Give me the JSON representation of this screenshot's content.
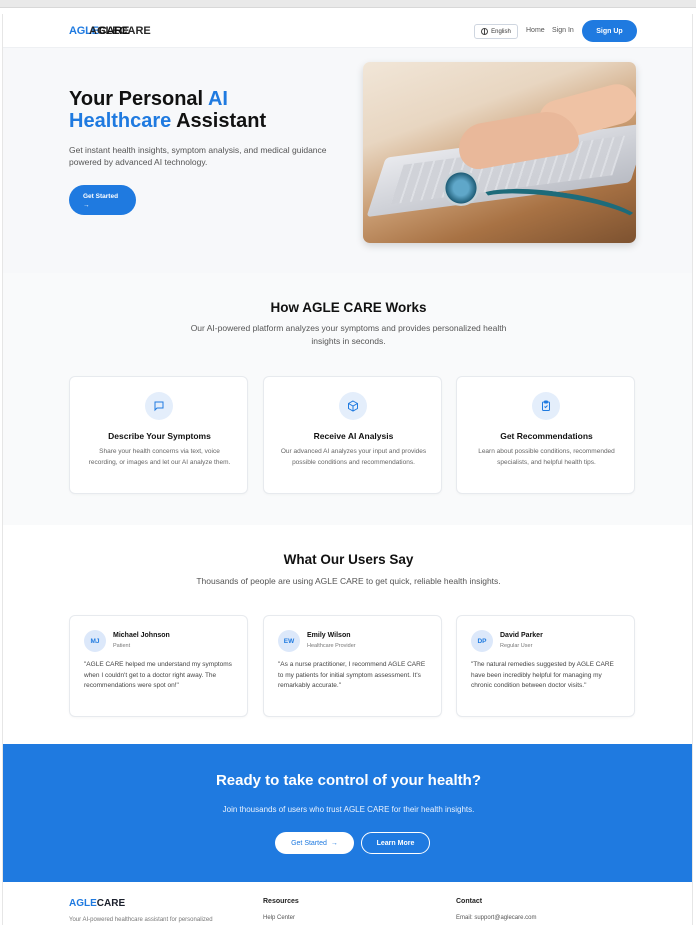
{
  "nav": {
    "logo_part1": "AGLE",
    "logo_part2": "CARE",
    "logo_overlap": "AGLECARE",
    "language": "English",
    "home": "Home",
    "signin": "Sign In",
    "signup": "Sign Up"
  },
  "hero": {
    "title_line1_plain": "Your Personal ",
    "title_line1_accent": "AI",
    "title_line2_accent": "Healthcare",
    "title_line2_plain": " Assistant",
    "subtitle": "Get instant health insights, symptom analysis, and medical guidance powered by advanced AI technology.",
    "cta": "Get Started",
    "cta_arrow": "→"
  },
  "how": {
    "title": "How AGLE CARE Works",
    "subtitle": "Our AI-powered platform analyzes your symptoms and provides personalized health insights in seconds.",
    "features": [
      {
        "icon": "chat-icon",
        "title": "Describe Your Symptoms",
        "desc": "Share your health concerns via text, voice recording, or images and let our AI analyze them."
      },
      {
        "icon": "cube-icon",
        "title": "Receive AI Analysis",
        "desc": "Our advanced AI analyzes your input and provides possible conditions and recommendations."
      },
      {
        "icon": "clipboard-check-icon",
        "title": "Get Recommendations",
        "desc": "Learn about possible conditions, recommended specialists, and helpful health tips."
      }
    ]
  },
  "testimonials": {
    "title": "What Our Users Say",
    "subtitle": "Thousands of people are using AGLE CARE to get quick, reliable health insights.",
    "items": [
      {
        "initials": "MJ",
        "name": "Michael Johnson",
        "role": "Patient",
        "quote": "\"AGLE CARE helped me understand my symptoms when I couldn't get to a doctor right away. The recommendations were spot on!\""
      },
      {
        "initials": "EW",
        "name": "Emily Wilson",
        "role": "Healthcare Provider",
        "quote": "\"As a nurse practitioner, I recommend AGLE CARE to my patients for initial symptom assessment. It's remarkably accurate.\""
      },
      {
        "initials": "DP",
        "name": "David Parker",
        "role": "Regular User",
        "quote": "\"The natural remedies suggested by AGLE CARE have been incredibly helpful for managing my chronic condition between doctor visits.\""
      }
    ]
  },
  "cta": {
    "title": "Ready to take control of your health?",
    "subtitle": "Join thousands of users who trust AGLE CARE for their health insights.",
    "primary": "Get Started",
    "primary_arrow": "→",
    "secondary": "Learn More"
  },
  "footer": {
    "logo_part1": "AGLE",
    "logo_part2": "CARE",
    "desc": "Your AI-powered healthcare assistant for personalized",
    "resources_heading": "Resources",
    "resources_first": "Help Center",
    "contact_heading": "Contact",
    "contact_email": "Email: support@aglecare.com"
  },
  "colors": {
    "accent": "#1f7ae0",
    "hero_bg": "#f7f8fa",
    "avatar_bg": "#dce8fa"
  }
}
